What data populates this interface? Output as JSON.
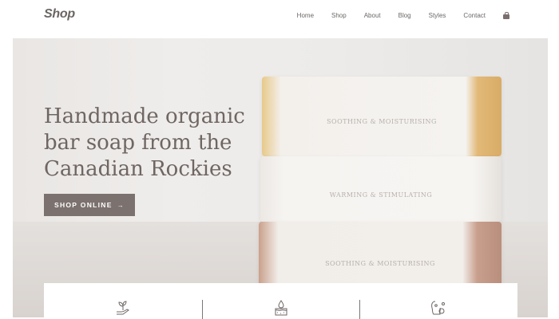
{
  "header": {
    "logo": "Shop",
    "nav": [
      {
        "label": "Home"
      },
      {
        "label": "Shop"
      },
      {
        "label": "About"
      },
      {
        "label": "Blog"
      },
      {
        "label": "Styles"
      },
      {
        "label": "Contact"
      }
    ],
    "cart_icon": "shopping-bag-icon"
  },
  "hero": {
    "headline_lines": [
      "Handmade organic",
      "bar soap from the",
      "Canadian Rockies"
    ],
    "cta_label": "SHOP ONLINE",
    "cta_arrow": "→",
    "soaps": [
      {
        "label": "SOOTHING & MOISTURISING"
      },
      {
        "label": "WARMING & STIMULATING"
      },
      {
        "label": "SOOTHING & MOISTURISING"
      }
    ]
  },
  "features": {
    "icons": [
      "seedling-hand-icon",
      "water-drop-skin-icon",
      "skin-care-face-icon"
    ]
  },
  "colors": {
    "accent": "#7b716e",
    "text": "#6f6663"
  }
}
